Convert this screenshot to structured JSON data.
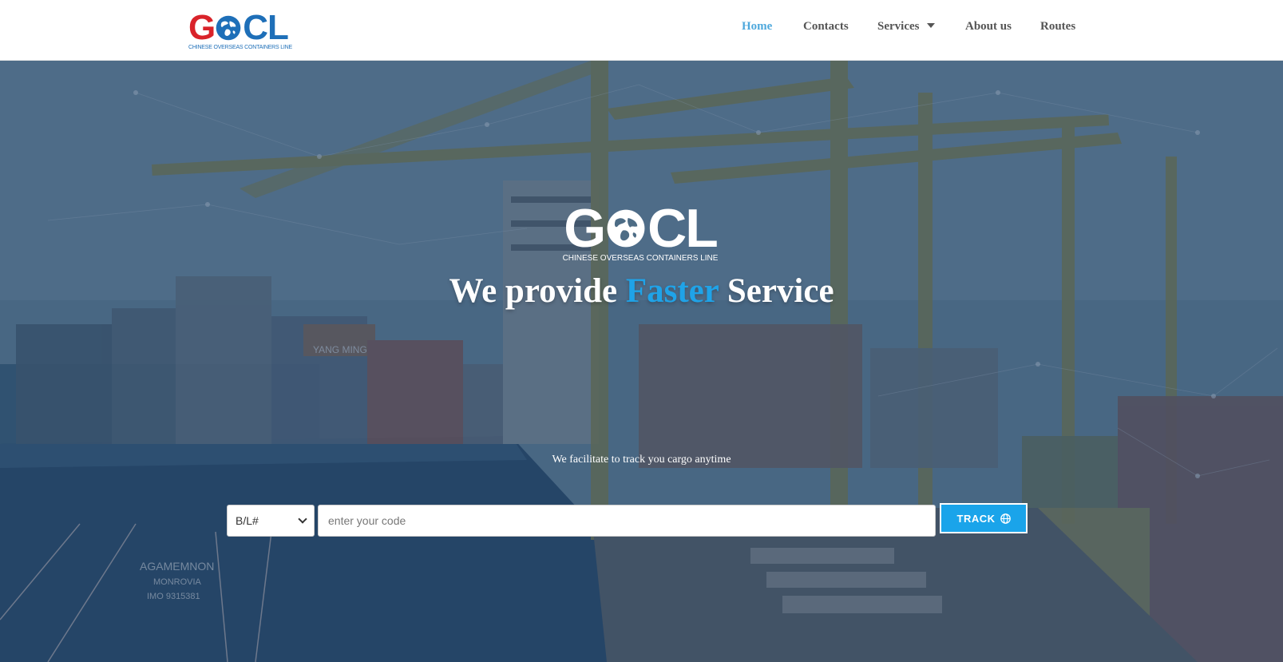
{
  "brand": {
    "logo_letters_left": "G",
    "logo_letters_right": "CL",
    "logo_subtitle": "CHINESE OVERSEAS CONTAINERS LINE",
    "color_red": "#d9232a",
    "color_blue": "#1e6fb8"
  },
  "nav": {
    "items": [
      {
        "label": "Home",
        "active": true
      },
      {
        "label": "Contacts",
        "active": false
      },
      {
        "label": "Services",
        "active": false
      },
      {
        "label": "About us",
        "active": false
      },
      {
        "label": "Routes",
        "active": false
      }
    ],
    "active_color": "#4ea8dc"
  },
  "hero": {
    "logo_left": "G",
    "logo_right": "CL",
    "logo_subtitle": "CHINESE OVERSEAS CONTAINERS LINE",
    "headline_before": "We provide ",
    "headline_accent": "Faster",
    "headline_after": " Service",
    "accent_color": "#1fa3e8",
    "subline": "We facilitate to track you cargo anytime"
  },
  "tracking": {
    "type_selected": "B/L#",
    "code_placeholder": "enter your code",
    "code_value": "",
    "button_label": "TRACK",
    "button_icon": "globe-icon",
    "button_color": "#1aa4ea"
  }
}
